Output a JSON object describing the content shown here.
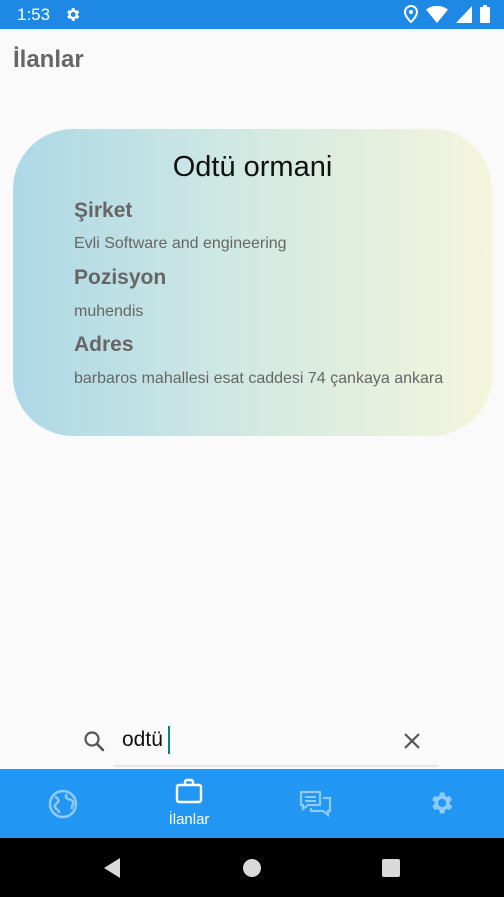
{
  "status_bar": {
    "time": "1:53"
  },
  "app_bar": {
    "title": "İlanlar"
  },
  "card": {
    "title": "Odtü ormani",
    "company_label": "Şirket",
    "company_value": "Evli Software and engineering",
    "position_label": "Pozisyon",
    "position_value": "muhendis",
    "address_label": "Adres",
    "address_value": "barbaros mahallesi esat caddesi 74 çankaya ankara"
  },
  "search": {
    "value": "odtü"
  },
  "bottom_nav": {
    "items": [
      {
        "icon": "globe-icon",
        "label": ""
      },
      {
        "icon": "briefcase-icon",
        "label": "İlanlar"
      },
      {
        "icon": "chat-icon",
        "label": ""
      },
      {
        "icon": "settings-icon",
        "label": ""
      }
    ]
  },
  "colors": {
    "status_bar": "#1e88e5",
    "bottom_nav": "#2196f3",
    "card_gradient_start": "#add8e6",
    "card_gradient_end": "#f5f5dc"
  }
}
